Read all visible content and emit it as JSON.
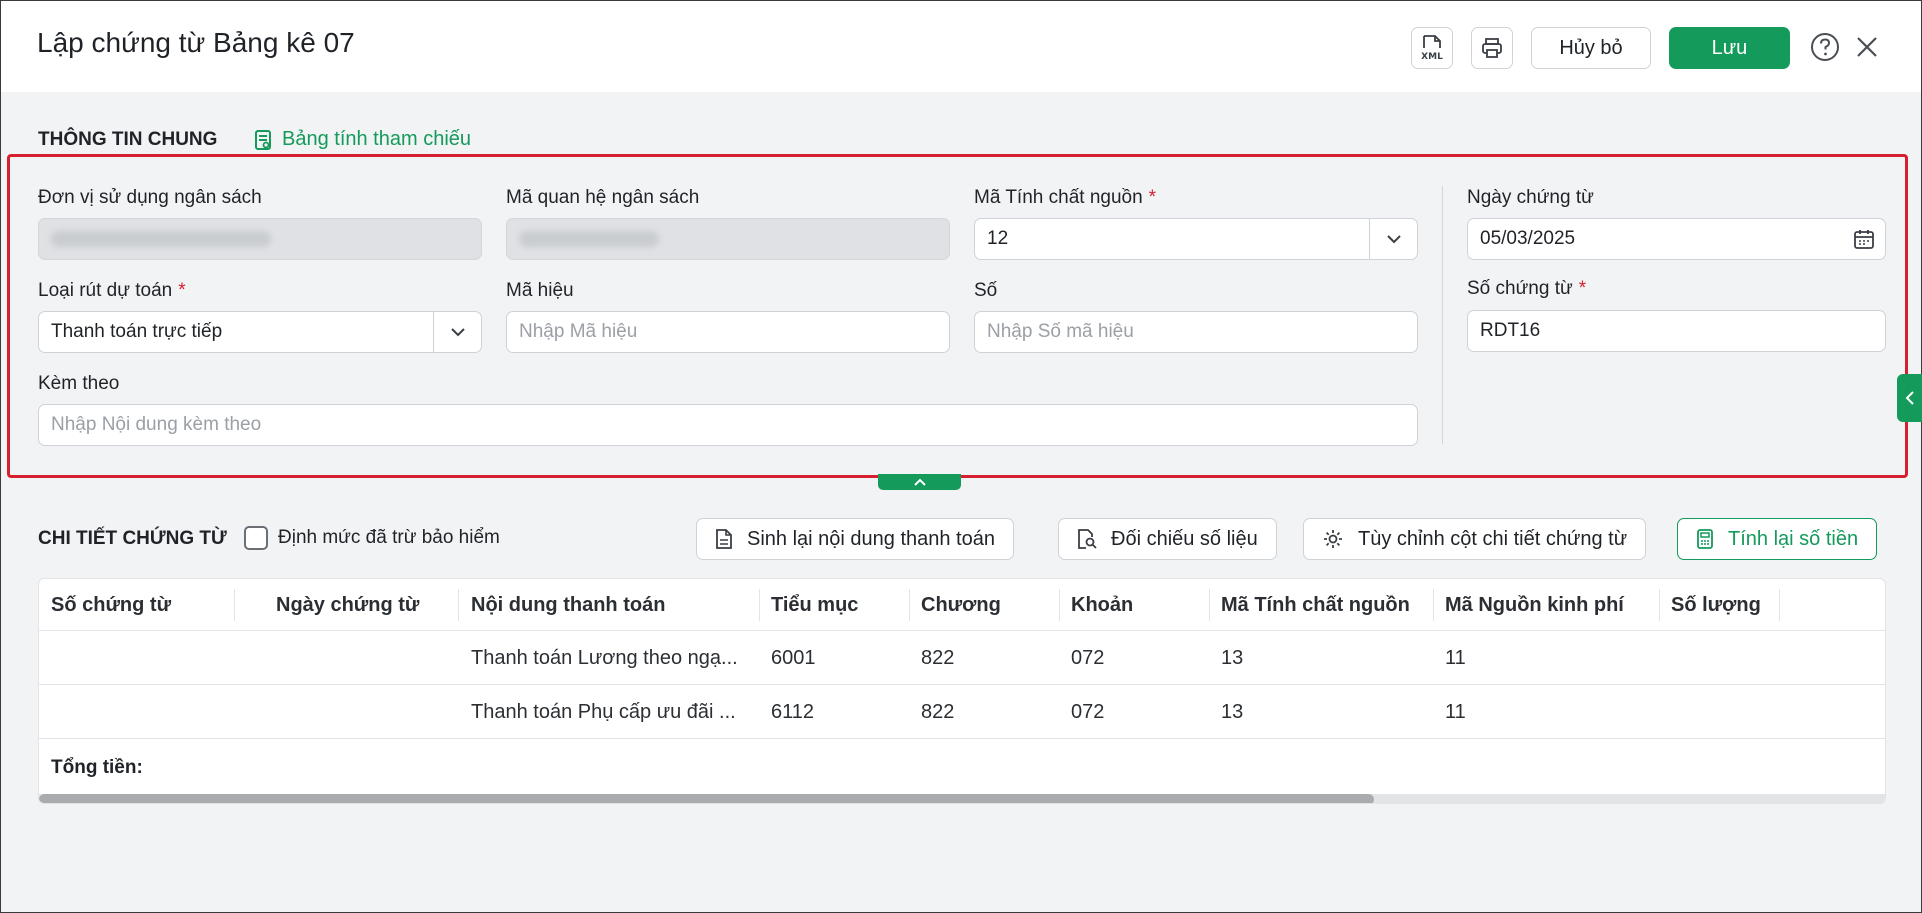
{
  "dialog": {
    "title": "Lập chứng từ Bảng kê 07",
    "xml_label": "XML",
    "cancel_label": "Hủy bỏ",
    "save_label": "Lưu"
  },
  "general": {
    "section_title": "THÔNG TIN CHUNG",
    "reference_link": "Bảng tính tham chiếu",
    "fields": {
      "don_vi": {
        "label": "Đơn vị sử dụng ngân sách"
      },
      "ma_qhns": {
        "label": "Mã quan hệ ngân sách"
      },
      "tinh_chat_nguon": {
        "label": "Mã Tính chất nguồn",
        "required": "*",
        "value": "12"
      },
      "ngay_chung_tu": {
        "label": "Ngày chứng từ",
        "value": "05/03/2025"
      },
      "loai_rut": {
        "label": "Loại rút dự toán",
        "required": "*",
        "value": "Thanh toán trực tiếp"
      },
      "ma_hieu": {
        "label": "Mã hiệu",
        "placeholder": "Nhập Mã hiệu"
      },
      "so": {
        "label": "Số",
        "placeholder": "Nhập Số mã hiệu"
      },
      "so_chung_tu": {
        "label": "Số chứng từ",
        "required": "*",
        "value": "RDT16"
      },
      "kem_theo": {
        "label": "Kèm theo",
        "placeholder": "Nhập Nội dung kèm theo"
      }
    }
  },
  "detail": {
    "section_title": "CHI TIẾT CHỨNG TỪ",
    "checkbox_label": "Định mức đã trừ bảo hiểm",
    "buttons": {
      "regenerate": "Sinh lại nội dung thanh toán",
      "reconcile": "Đối chiếu số liệu",
      "customize": "Tùy chỉnh cột chi tiết chứng từ",
      "recalculate": "Tính lại số tiền"
    },
    "columns": [
      "Số chứng từ",
      "Ngày chứng từ",
      "Nội dung thanh toán",
      "Tiểu mục",
      "Chương",
      "Khoản",
      "Mã Tính chất nguồn",
      "Mã Nguồn kinh phí",
      "Số lượng"
    ],
    "rows": [
      [
        "",
        "",
        "Thanh toán Lương theo ngạ...",
        "6001",
        "822",
        "072",
        "13",
        "11",
        ""
      ],
      [
        "",
        "",
        "Thanh toán Phụ cấp ưu đãi ...",
        "6112",
        "822",
        "072",
        "13",
        "11",
        ""
      ]
    ],
    "total_label": "Tổng tiền:"
  },
  "colors": {
    "primary": "#149a5a",
    "highlight": "#d6202f",
    "background": "#f2f3f5"
  }
}
